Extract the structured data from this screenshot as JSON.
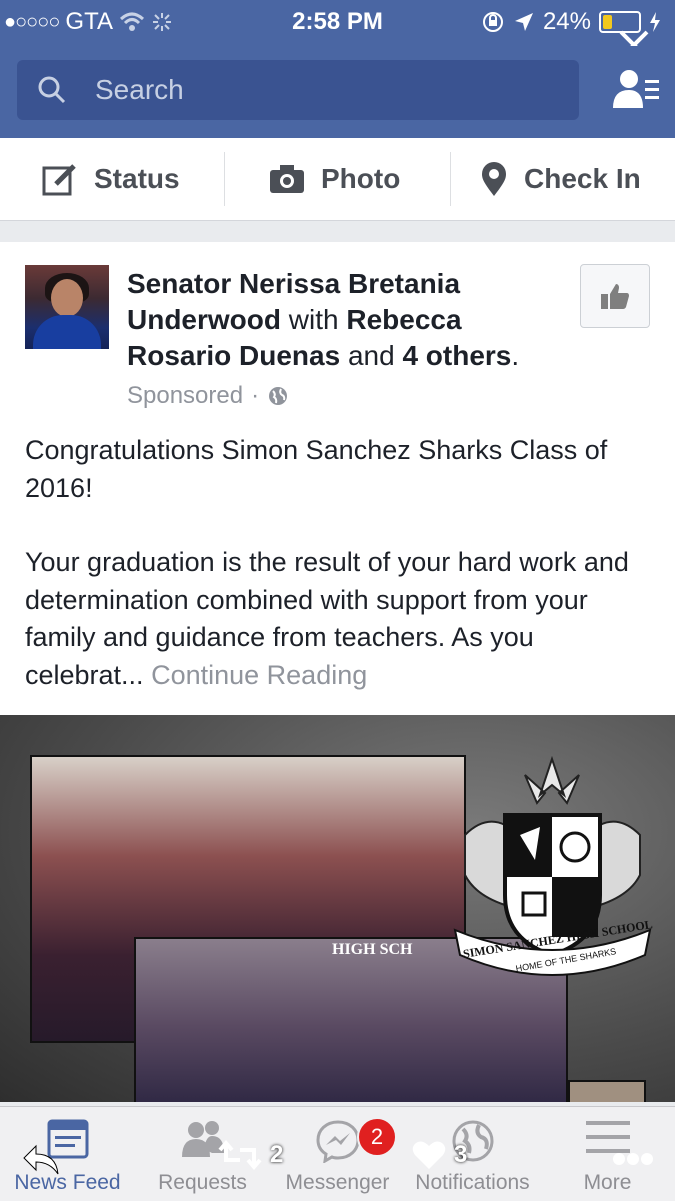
{
  "status_bar": {
    "signal_dots": "●○○○○",
    "carrier": "GTA",
    "time": "2:58 PM",
    "battery_percent": "24%",
    "battery_level": 0.24
  },
  "search": {
    "placeholder": "Search"
  },
  "composer": {
    "status_label": "Status",
    "photo_label": "Photo",
    "checkin_label": "Check In"
  },
  "post": {
    "author": "Senator Nerissa Bretania Underwood",
    "with_word": "with",
    "tagged": "Rebecca Rosario Duenas",
    "and_word": "and",
    "others": "4 others",
    "period": ".",
    "sponsored": "Sponsored",
    "separator": "·",
    "text_p1": "Congratulations Simon Sanchez Sharks Class of 2016!",
    "text_p2": "Your graduation is the result of your hard work and determination combined with support from your family and guidance from teachers. As you celebrat...",
    "continue_reading": "Continue Reading",
    "image_text_banner": "HIGH SCH",
    "crest_name": "SIMON SANCHEZ HIGH SCHOOL",
    "crest_motto": "HOME OF THE SHARKS"
  },
  "tabbar": {
    "tabs": [
      {
        "label": "News Feed",
        "icon": "news-feed-icon",
        "active": true
      },
      {
        "label": "Requests",
        "icon": "friend-requests-icon",
        "active": false
      },
      {
        "label": "Messenger",
        "icon": "messenger-icon",
        "active": false
      },
      {
        "label": "Notifications",
        "icon": "globe-icon",
        "active": false
      },
      {
        "label": "More",
        "icon": "menu-icon",
        "active": false
      }
    ],
    "messenger_badge": "2"
  },
  "overlay": {
    "retweet_count": "2",
    "like_count": "3"
  },
  "colors": {
    "brand_blue": "#4a66a3",
    "badge_red": "#e02020",
    "battery_yellow": "#f2c81e"
  }
}
